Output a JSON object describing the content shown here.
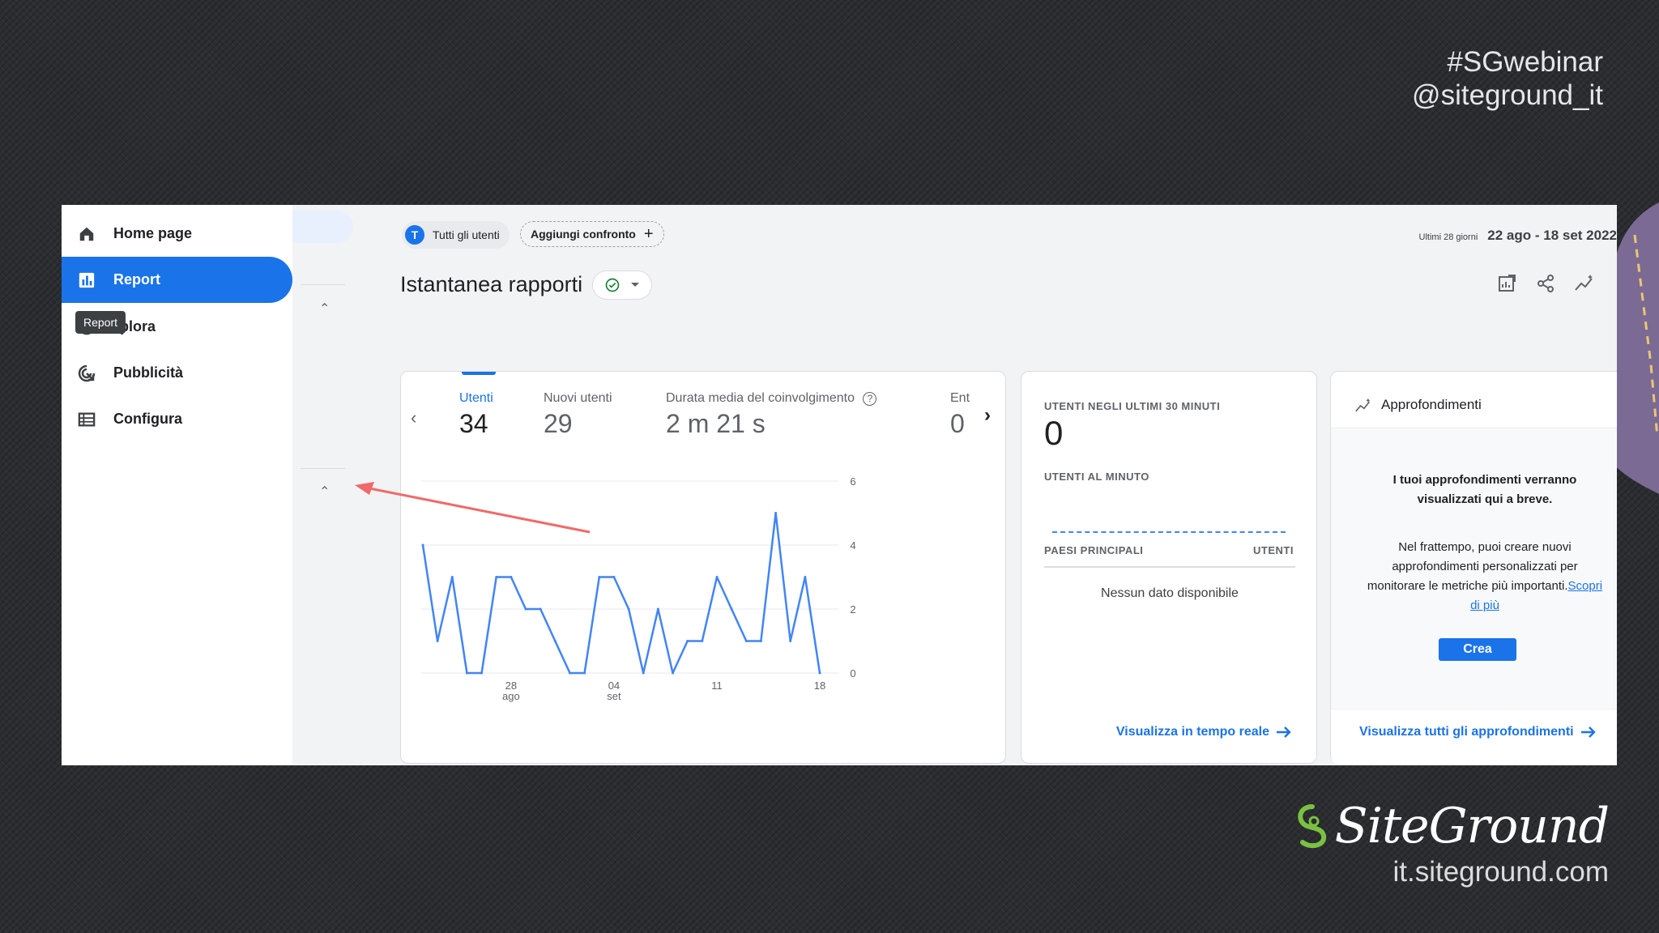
{
  "slide": {
    "hashtag": "#SGwebinar",
    "handle": "@siteground_it",
    "brand_name": "SiteGround",
    "brand_url": "it.siteground.com",
    "brand_color": "#7ac142"
  },
  "sidebar": {
    "items": [
      {
        "label": "Home page",
        "icon": "home-icon",
        "active": false
      },
      {
        "label": "Report",
        "icon": "bar-chart-icon",
        "active": true
      },
      {
        "label": "plora",
        "icon": "explore-icon",
        "active": false
      },
      {
        "label": "Pubblicità",
        "icon": "advertising-icon",
        "active": false
      },
      {
        "label": "Configura",
        "icon": "configure-icon",
        "active": false
      }
    ],
    "tooltip": "Report"
  },
  "toolbar": {
    "users_chip_initial": "T",
    "users_chip_label": "Tutti gli utenti",
    "compare_label": "Aggiungi confronto",
    "date_prefix": "Ultimi 28 giorni",
    "date_range": "22 ago - 18 set 2022"
  },
  "page": {
    "title": "Istantanea rapporti",
    "status": "check-circle-icon"
  },
  "metrics": [
    {
      "label": "Utenti",
      "value": "34",
      "selected": true
    },
    {
      "label": "Nuovi utenti",
      "value": "29",
      "selected": false
    },
    {
      "label": "Durata media del coinvolgimento",
      "value": "2 m 21 s",
      "selected": false
    },
    {
      "label": "Ent",
      "value": "0",
      "selected": false
    }
  ],
  "chart_data": {
    "type": "line",
    "x": [
      1,
      2,
      3,
      4,
      5,
      6,
      7,
      8,
      9,
      10,
      11,
      12,
      13,
      14,
      15,
      16,
      17,
      18,
      19,
      20,
      21,
      22,
      23,
      24,
      25,
      26,
      27,
      28
    ],
    "x_tick_labels": [
      {
        "line1": "28",
        "line2": "ago",
        "index": 7
      },
      {
        "line1": "04",
        "line2": "set",
        "index": 14
      },
      {
        "line1": "11",
        "line2": "",
        "index": 21
      },
      {
        "line1": "18",
        "line2": "",
        "index": 28
      }
    ],
    "values": [
      4,
      1,
      3,
      0,
      0,
      3,
      3,
      2,
      2,
      1,
      0,
      0,
      3,
      3,
      2,
      0,
      2,
      0,
      1,
      1,
      3,
      2,
      1,
      1,
      5,
      1,
      3,
      0
    ],
    "ylim": [
      0,
      6
    ],
    "y_ticks": [
      "0",
      "2",
      "4",
      "6"
    ],
    "color": "#4285f4",
    "grid": true
  },
  "realtime": {
    "heading": "UTENTI NEGLI ULTIMI 30 MINUTI",
    "value": "0",
    "per_minute": "UTENTI AL MINUTO",
    "col_country": "PAESI PRINCIPALI",
    "col_users": "UTENTI",
    "empty": "Nessun dato disponibile",
    "link": "Visualizza in tempo reale"
  },
  "insights": {
    "title": "Approfondimenti",
    "message": "I tuoi approfondimenti verranno visualizzati qui a breve.",
    "body": "Nel frattempo, puoi creare nuovi approfondimenti personalizzati per monitorare le metriche più importanti.",
    "learn_more": "Scopri di più",
    "button": "Crea",
    "link": "Visualizza tutti gli approfondimenti"
  }
}
